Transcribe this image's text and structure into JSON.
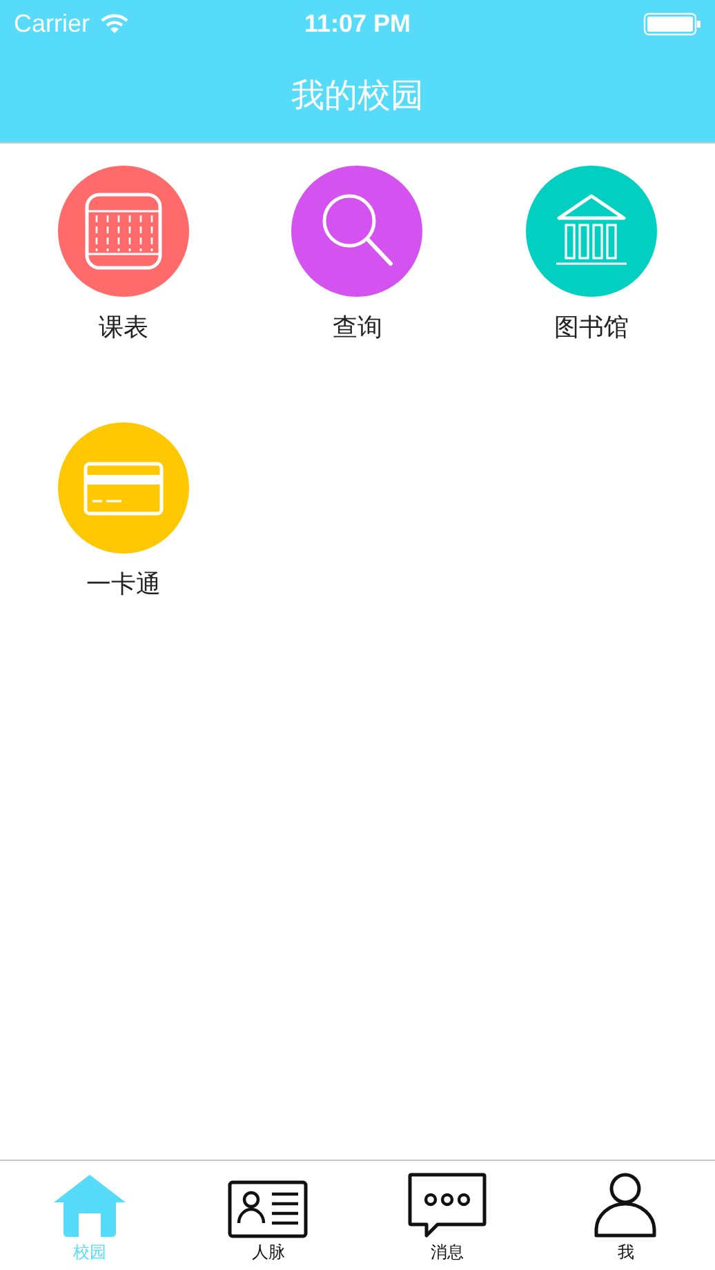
{
  "status_bar": {
    "carrier": "Carrier",
    "time": "11:07 PM"
  },
  "nav_bar": {
    "title": "我的校园"
  },
  "tiles": [
    {
      "kind": "timetable",
      "label": "课表",
      "color": "#ff6b6b"
    },
    {
      "kind": "search",
      "label": "查询",
      "color": "#d452ef"
    },
    {
      "kind": "library",
      "label": "图书馆",
      "color": "#00cfc1"
    },
    {
      "kind": "card",
      "label": "一卡通",
      "color": "#ffc800"
    }
  ],
  "tab_bar": [
    {
      "kind": "home",
      "label": "校园",
      "selected": true
    },
    {
      "kind": "contacts",
      "label": "人脉",
      "selected": false
    },
    {
      "kind": "messages",
      "label": "消息",
      "selected": false
    },
    {
      "kind": "profile",
      "label": "我",
      "selected": false
    }
  ]
}
